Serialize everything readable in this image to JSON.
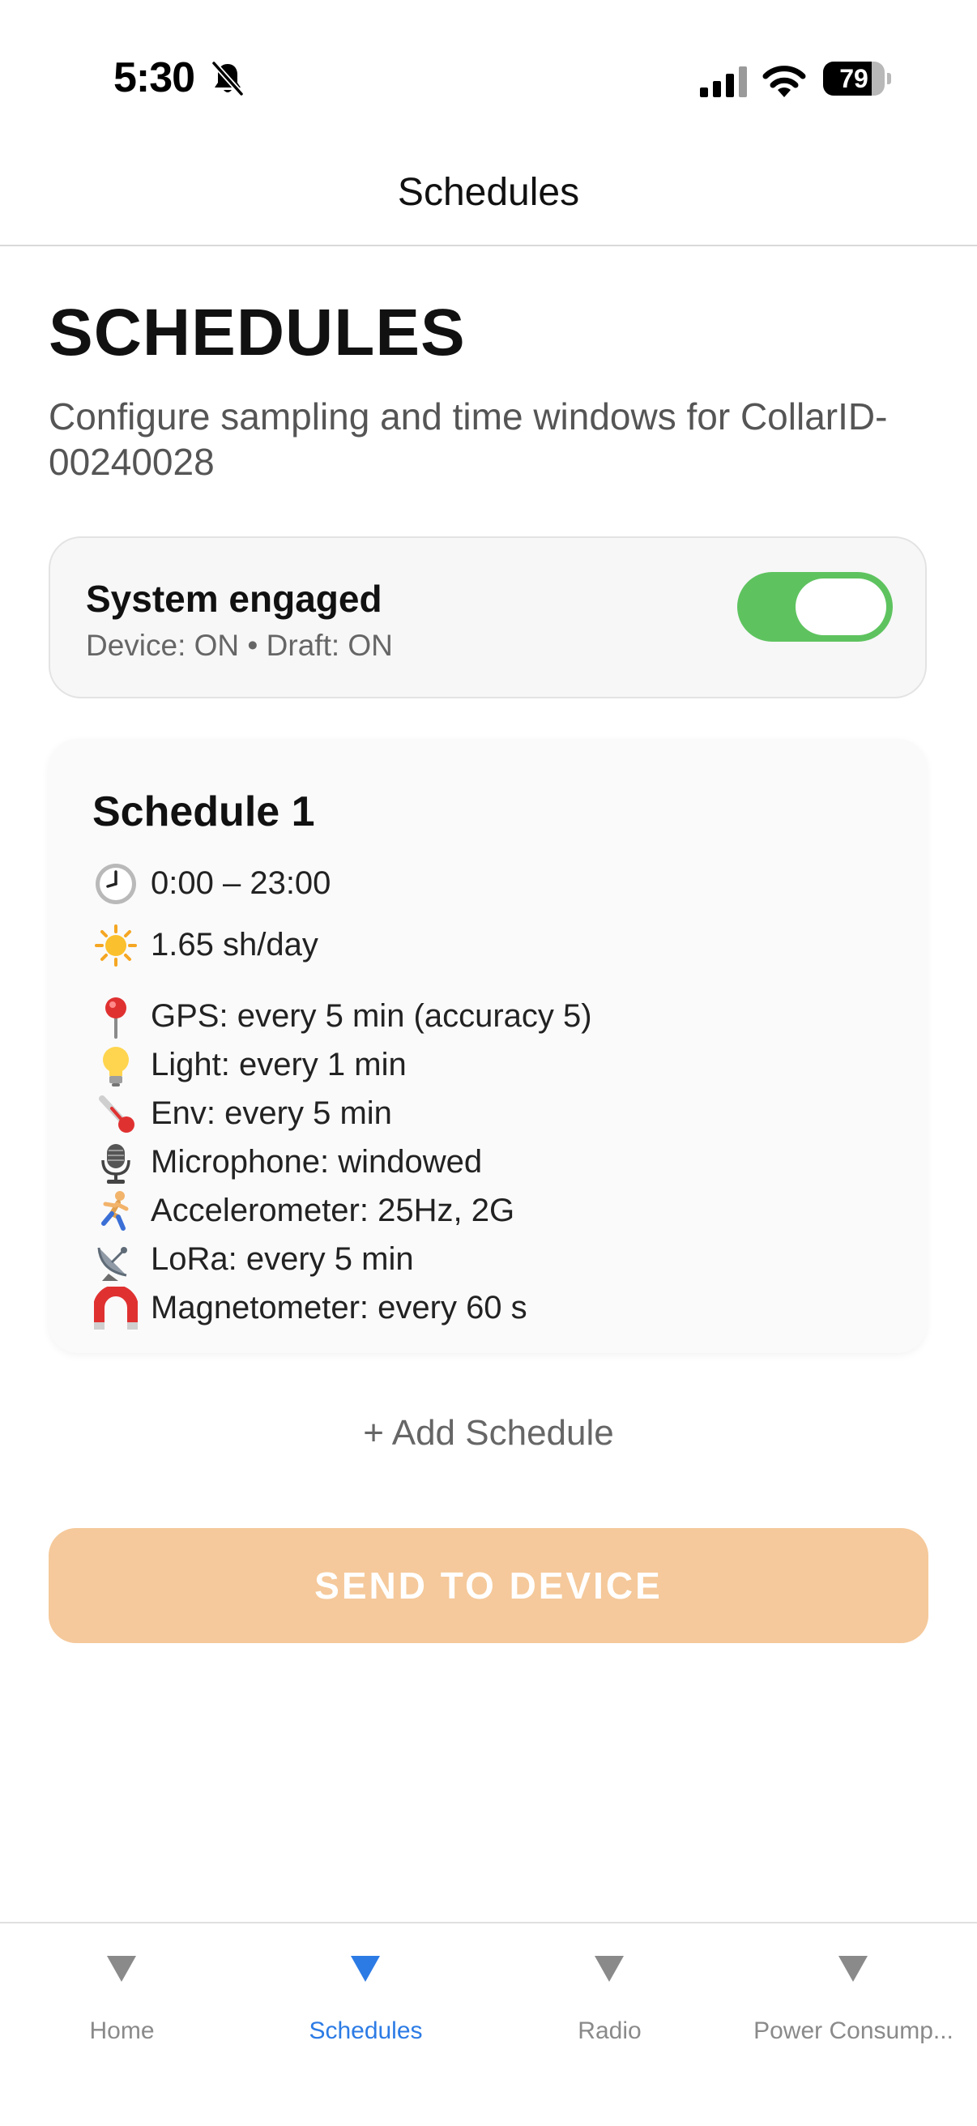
{
  "status_bar": {
    "time": "5:30",
    "battery_level": "79",
    "battery_fraction": 0.79
  },
  "nav": {
    "title": "Schedules"
  },
  "header": {
    "title": "SCHEDULES",
    "subtitle": "Configure sampling and time windows for CollarID-00240028"
  },
  "system": {
    "title": "System engaged",
    "status": "Device: ON • Draft: ON",
    "enabled": true
  },
  "schedule": {
    "title": "Schedule 1",
    "time_window": {
      "icon": "clock-icon",
      "text": "0:00 – 23:00"
    },
    "sun": {
      "icon": "sun-icon",
      "text": "1.65 sh/day"
    },
    "sensors": [
      {
        "icon": "pin-icon",
        "text": "GPS: every 5 min (accuracy 5)"
      },
      {
        "icon": "lightbulb-icon",
        "text": "Light: every 1 min"
      },
      {
        "icon": "thermometer-icon",
        "text": "Env: every 5 min"
      },
      {
        "icon": "microphone-icon",
        "text": "Microphone: windowed"
      },
      {
        "icon": "runner-icon",
        "text": "Accelerometer: 25Hz, 2G"
      },
      {
        "icon": "satellite-dish-icon",
        "text": "LoRa: every 5 min"
      },
      {
        "icon": "magnet-icon",
        "text": "Magnetometer: every 60 s"
      }
    ]
  },
  "actions": {
    "add_schedule": "+ Add Schedule",
    "send_to_device": "SEND TO DEVICE"
  },
  "tabs": [
    {
      "label": "Home",
      "active": false
    },
    {
      "label": "Schedules",
      "active": true
    },
    {
      "label": "Radio",
      "active": false
    },
    {
      "label": "Power Consump...",
      "active": false
    }
  ],
  "colors": {
    "accent_blue": "#2c7be5",
    "toggle_green": "#5ec35f",
    "send_button": "#f5c99b",
    "inactive_tab": "#8a8a8a"
  }
}
